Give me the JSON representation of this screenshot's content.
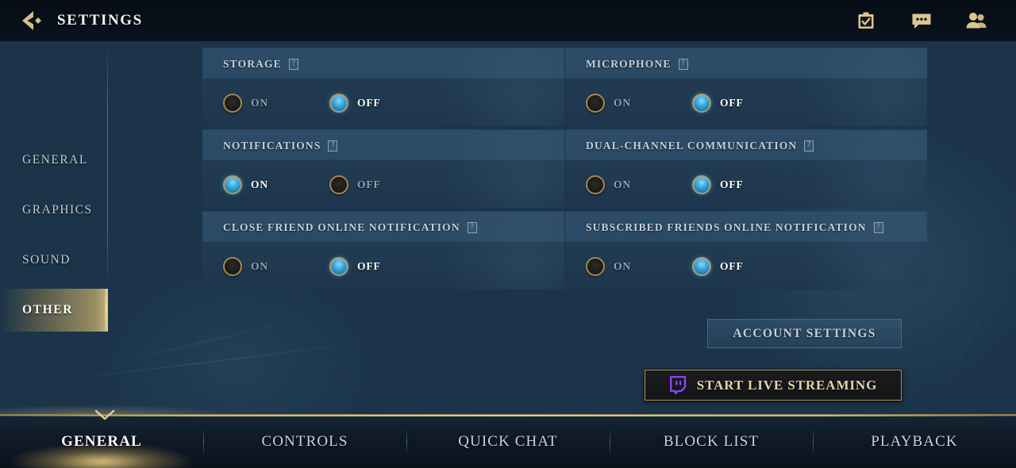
{
  "header": {
    "title": "SETTINGS",
    "back_icon": "chevron-left-icon",
    "icons": [
      {
        "name": "missions-checklist-icon",
        "glyph": "checklist"
      },
      {
        "name": "chat-bubble-icon",
        "glyph": "chat"
      },
      {
        "name": "friends-icon",
        "glyph": "people"
      }
    ]
  },
  "sidebar": {
    "items": [
      {
        "label": "GENERAL",
        "active": false
      },
      {
        "label": "GRAPHICS",
        "active": false
      },
      {
        "label": "SOUND",
        "active": false
      },
      {
        "label": "OTHER",
        "active": true
      }
    ]
  },
  "settings": {
    "help_glyph": "?",
    "on_label": "ON",
    "off_label": "OFF",
    "panels": [
      {
        "title": "STORAGE",
        "value": "OFF"
      },
      {
        "title": "MICROPHONE",
        "value": "OFF"
      },
      {
        "title": "NOTIFICATIONS",
        "value": "ON"
      },
      {
        "title": "DUAL-CHANNEL COMMUNICATION",
        "value": "OFF"
      },
      {
        "title": "CLOSE FRIEND ONLINE NOTIFICATION",
        "value": "OFF"
      },
      {
        "title": "SUBSCRIBED FRIENDS ONLINE NOTIFICATION",
        "value": "OFF"
      }
    ]
  },
  "actions": {
    "account_settings_label": "ACCOUNT SETTINGS",
    "start_live_streaming_label": "START LIVE STREAMING",
    "twitch_icon_color": "#9147ff"
  },
  "tabbar": {
    "tabs": [
      {
        "label": "GENERAL",
        "active": true
      },
      {
        "label": "CONTROLS",
        "active": false
      },
      {
        "label": "QUICK CHAT",
        "active": false
      },
      {
        "label": "BLOCK LIST",
        "active": false
      },
      {
        "label": "PLAYBACK",
        "active": false
      }
    ]
  },
  "colors": {
    "gold": "#c8ab6b",
    "accent_blue": "#3aa9dd",
    "panel_bg": "#22405a",
    "text_primary": "#ffffff",
    "text_muted": "#93a3b2"
  }
}
